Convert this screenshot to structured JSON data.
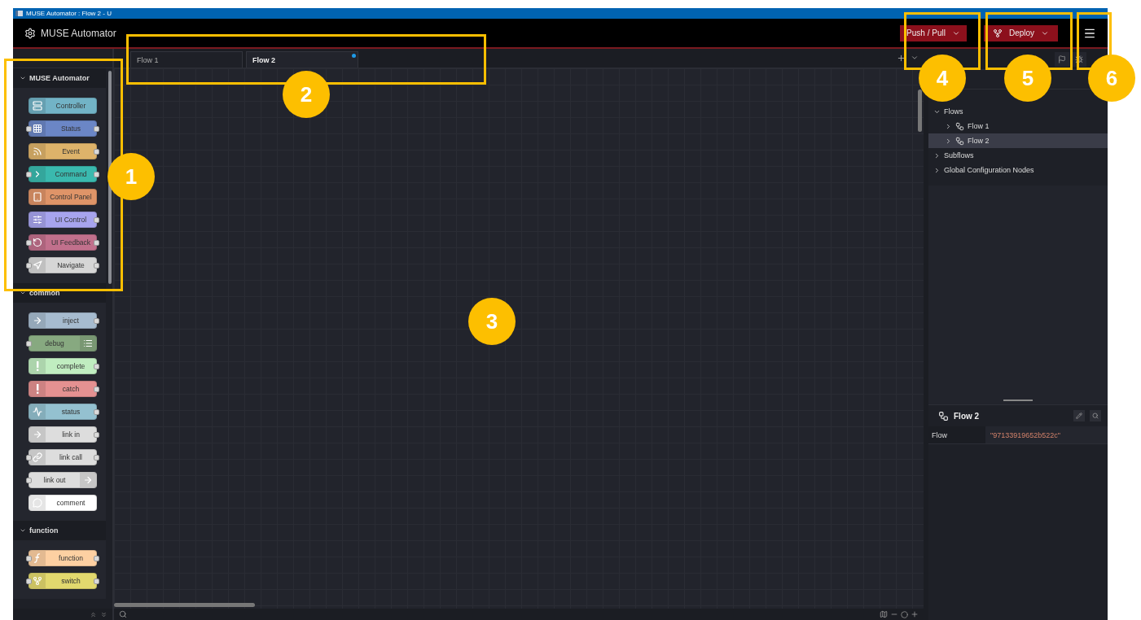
{
  "window": {
    "title": "MUSE Automator : Flow 2 - U"
  },
  "header": {
    "app_name": "MUSE Automator",
    "buttons": [
      {
        "label": "Push / Pull",
        "kind": "plain"
      },
      {
        "label": "Deploy",
        "kind": "deploy"
      }
    ]
  },
  "palette": {
    "categories": [
      {
        "name": "MUSE Automator",
        "expanded": true,
        "nodes": [
          {
            "label": "Controller",
            "color": "#72b3c6",
            "kind": "server",
            "input": false,
            "output": false,
            "icon_right": false
          },
          {
            "label": "Status",
            "color": "#6b86c6",
            "kind": "grid",
            "input": true,
            "output": true,
            "icon_right": false
          },
          {
            "label": "Event",
            "color": "#deb36a",
            "kind": "rss",
            "input": false,
            "output": true,
            "icon_right": false
          },
          {
            "label": "Command",
            "color": "#3ab9ae",
            "kind": "chevron",
            "input": true,
            "output": true,
            "icon_right": false
          },
          {
            "label": "Control Panel",
            "color": "#df9468",
            "kind": "tablet",
            "input": false,
            "output": false,
            "icon_right": false
          },
          {
            "label": "UI Control",
            "color": "#a7a4ee",
            "kind": "sliders",
            "input": false,
            "output": true,
            "icon_right": false
          },
          {
            "label": "UI Feedback",
            "color": "#c1708c",
            "kind": "rotate",
            "input": true,
            "output": true,
            "icon_right": false
          },
          {
            "label": "Navigate",
            "color": "#d6d6d6",
            "kind": "navigate",
            "input": true,
            "output": true,
            "icon_right": false
          }
        ]
      },
      {
        "name": "common",
        "expanded": true,
        "nodes": [
          {
            "label": "inject",
            "color": "#a6bbcf",
            "kind": "arrow",
            "input": false,
            "output": true,
            "icon_right": false
          },
          {
            "label": "debug",
            "color": "#87a980",
            "kind": "list",
            "input": true,
            "output": false,
            "icon_right": true
          },
          {
            "label": "complete",
            "color": "#c0edc0",
            "kind": "alert",
            "input": false,
            "output": true,
            "icon_right": false
          },
          {
            "label": "catch",
            "color": "#e49191",
            "kind": "alert",
            "input": false,
            "output": true,
            "icon_right": false
          },
          {
            "label": "status",
            "color": "#94c1d0",
            "kind": "pulse",
            "input": false,
            "output": true,
            "icon_right": false
          },
          {
            "label": "link in",
            "color": "#dddddd",
            "kind": "arrow",
            "input": false,
            "output": true,
            "icon_right": false
          },
          {
            "label": "link call",
            "color": "#dddddd",
            "kind": "link",
            "input": true,
            "output": true,
            "icon_right": false
          },
          {
            "label": "link out",
            "color": "#dddddd",
            "kind": "arrow",
            "input": true,
            "output": false,
            "icon_right": true
          },
          {
            "label": "comment",
            "color": "#ffffff",
            "kind": "comment",
            "input": false,
            "output": false,
            "icon_right": false
          }
        ]
      },
      {
        "name": "function",
        "expanded": true,
        "nodes": [
          {
            "label": "function",
            "color": "#fdd0a2",
            "kind": "function",
            "input": true,
            "output": true,
            "icon_right": false
          },
          {
            "label": "switch",
            "color": "#e2d96e",
            "kind": "fork",
            "input": true,
            "output": true,
            "icon_right": false
          }
        ]
      }
    ]
  },
  "workspace": {
    "tabs": [
      {
        "label": "Flow 1",
        "selected": false,
        "changed": false
      },
      {
        "label": "Flow 2",
        "selected": true,
        "changed": true
      }
    ]
  },
  "sidebar": {
    "tree": [
      {
        "label": "Flows",
        "expanded": true,
        "selected": false,
        "children": [
          {
            "label": "Flow 1",
            "selected": false
          },
          {
            "label": "Flow 2",
            "selected": true
          }
        ]
      },
      {
        "label": "Subflows",
        "expanded": false,
        "selected": false
      },
      {
        "label": "Global Configuration Nodes",
        "expanded": false,
        "selected": false
      }
    ],
    "details": {
      "title": "Flow 2",
      "rows": [
        {
          "key": "Flow",
          "value": "\"97133919652b522c\""
        }
      ]
    }
  },
  "callouts": [
    {
      "label": "1"
    },
    {
      "label": "2"
    },
    {
      "label": "3"
    },
    {
      "label": "4"
    },
    {
      "label": "5"
    },
    {
      "label": "6"
    }
  ]
}
